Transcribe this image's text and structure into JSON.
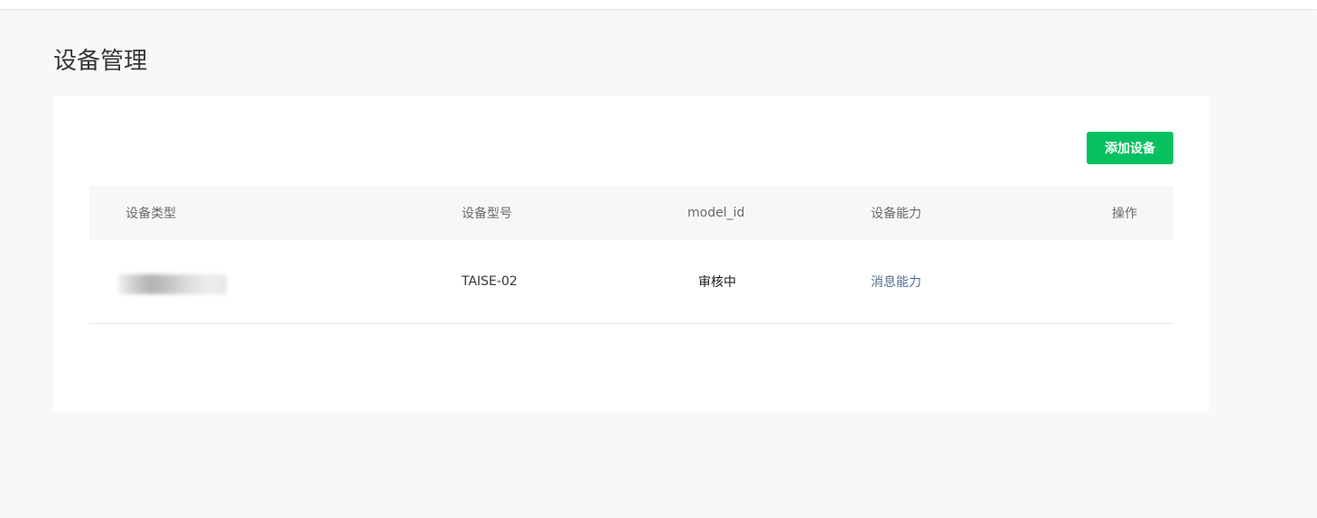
{
  "page": {
    "title": "设备管理"
  },
  "toolbar": {
    "add_label": "添加设备"
  },
  "table": {
    "headers": {
      "type": "设备类型",
      "model": "设备型号",
      "model_id": "model_id",
      "ability": "设备能力",
      "ops": "操作"
    },
    "rows": [
      {
        "type": "",
        "model": "TAISE-02",
        "model_id": "审核中",
        "ability": "消息能力",
        "ops": ""
      }
    ]
  },
  "colors": {
    "accent": "#07c160",
    "link": "#576b95",
    "background": "#f7f8fa"
  }
}
